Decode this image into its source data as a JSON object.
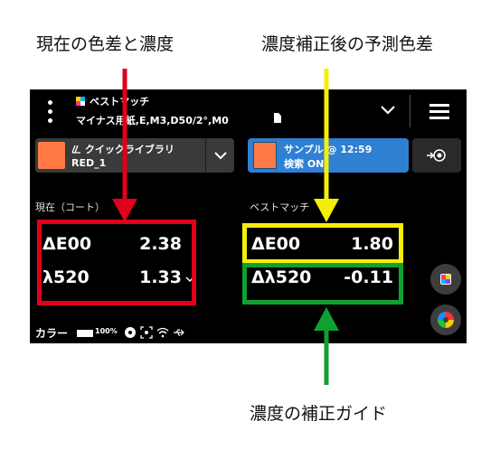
{
  "annotations": {
    "current_color_diff": "現在の色差と濃度",
    "predicted_color_diff": "濃度補正後の予測色差",
    "density_guide": "濃度の補正ガイド"
  },
  "topbar": {
    "mode_title": "ベストマッチ",
    "subtitle": "マイナス用紙,E,M3,D50/2°,M0"
  },
  "library": {
    "name": "クイックライブラリ",
    "item": "RED_1",
    "swatch_color": "#ff7a45"
  },
  "sample": {
    "title": "サンプル @ 12:59",
    "search_status": "検索 ON",
    "swatch_color": "#ff7a45"
  },
  "current": {
    "header": "現在（コート）",
    "metric1_label": "ΔE00",
    "metric1_value": "2.38",
    "metric2_label": "λ520",
    "metric2_value": "1.33"
  },
  "best_match": {
    "header": "ベストマッチ",
    "metric1_label": "ΔE00",
    "metric1_value": "1.80",
    "metric2_label": "Δλ520",
    "metric2_value": "-0.11"
  },
  "statusbar": {
    "color_label": "カラー",
    "battery": "100%"
  },
  "colors": {
    "red": "#e0001a",
    "yellow": "#f5ee0a",
    "green": "#10a030",
    "sample_card": "#2f7fd2"
  }
}
